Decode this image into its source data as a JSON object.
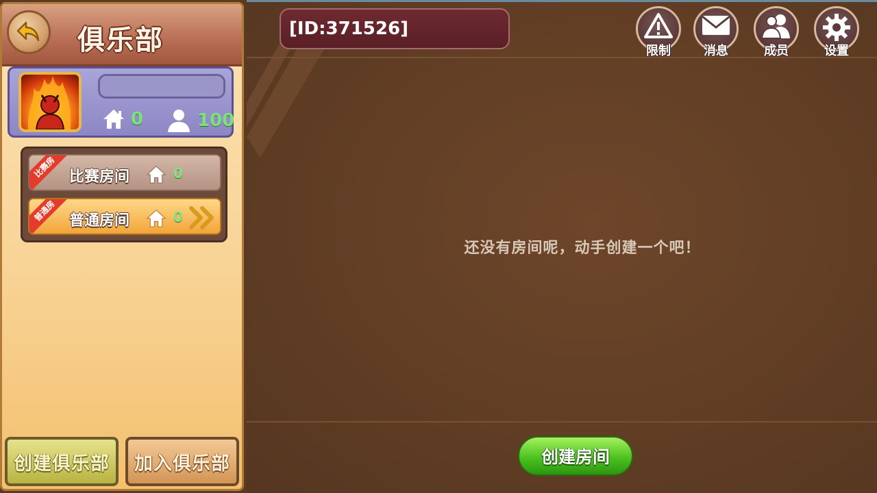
{
  "club": {
    "title": "俱乐部",
    "name": "",
    "room_count": "0",
    "member_count": "100"
  },
  "room_types": [
    {
      "ribbon": "比赛房",
      "label": "比赛房间",
      "count": "0",
      "selected": false
    },
    {
      "ribbon": "普通房",
      "label": "普通房间",
      "count": "0",
      "selected": true
    }
  ],
  "buttons": {
    "create_club": "创建俱乐部",
    "join_club": "加入俱乐部",
    "create_room": "创建房间"
  },
  "header": {
    "club_id": "[ID:371526]",
    "icons": [
      {
        "name": "warning-icon",
        "label": "限制"
      },
      {
        "name": "mail-icon",
        "label": "消息"
      },
      {
        "name": "members-icon",
        "label": "成员"
      },
      {
        "name": "gear-icon",
        "label": "设置"
      }
    ]
  },
  "main": {
    "empty_message": "还没有房间呢，动手创建一个吧！"
  },
  "colors": {
    "accent_green": "#4cc21e",
    "count_green": "#7de07d",
    "ribbon_red": "#e53b2b"
  }
}
